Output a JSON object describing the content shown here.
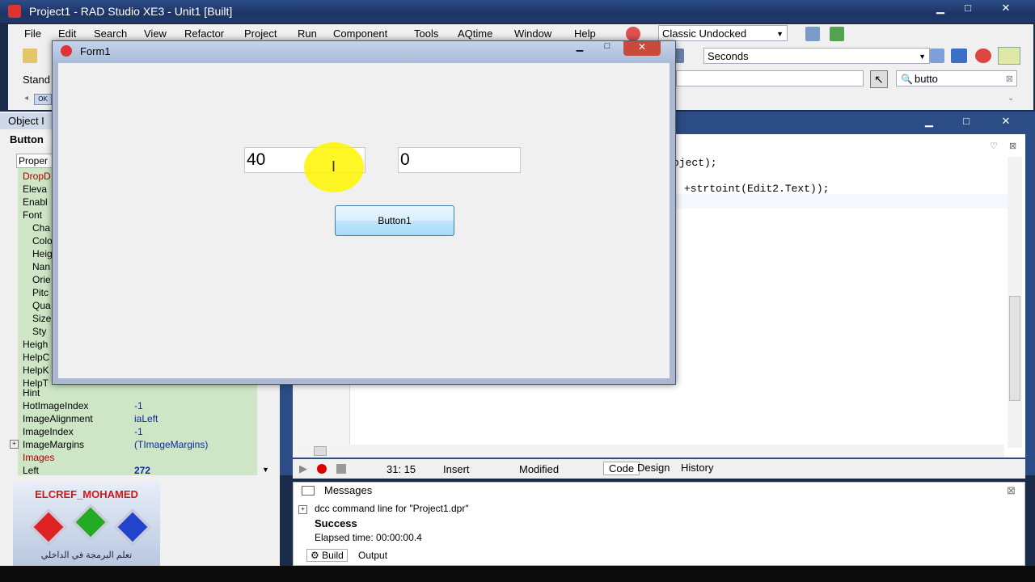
{
  "ide": {
    "title": "Project1 - RAD Studio XE3 - Unit1 [Built]",
    "menu": [
      "File",
      "Edit",
      "Search",
      "View",
      "Refactor",
      "Project",
      "Run",
      "Component",
      "Tools",
      "AQtime",
      "Window",
      "Help"
    ],
    "layout_combo": "Classic Undocked",
    "timer_combo": "Seconds",
    "search_value": "butto",
    "toolbar_left_label": "Stand"
  },
  "object_inspector": {
    "title": "Object I",
    "selected": "Button",
    "tab_label": "Proper",
    "rows_short": [
      "DropD",
      "Eleva",
      "Enabl",
      "Font",
      "Cha",
      "Colo",
      "Heig",
      "Nan",
      "Orie",
      "Pitc",
      "Qua",
      "Size",
      "Sty",
      "Heigh",
      "HelpC",
      "HelpK",
      "HelpT"
    ],
    "rows": [
      {
        "name": "Hint",
        "value": ""
      },
      {
        "name": "HotImageIndex",
        "value": "-1"
      },
      {
        "name": "ImageAlignment",
        "value": "iaLeft"
      },
      {
        "name": "ImageIndex",
        "value": "-1"
      },
      {
        "name": "ImageMargins",
        "value": "(TImageMargins)"
      },
      {
        "name": "Images",
        "value": ""
      },
      {
        "name": "Left",
        "value": "272"
      }
    ]
  },
  "form": {
    "title": "Form1",
    "edit1": "40",
    "edit2": "0",
    "button_label": "Button1"
  },
  "editor": {
    "line1": "bject);",
    "line2": "+strtoint(Edit2.Text));",
    "position": "31: 15",
    "mode": "Insert",
    "state": "Modified",
    "tabs": [
      "Code",
      "Design",
      "History"
    ]
  },
  "messages": {
    "title": "Messages",
    "line1": "dcc command line for \"Project1.dpr\"",
    "line2": "Success",
    "line3": "Elapsed time: 00:00:00.4",
    "tabs": [
      "Build",
      "Output"
    ]
  },
  "watermark": {
    "name": "ELCREF_MOHAMED",
    "tagline": "تعلم البرمجة في الداخلي"
  }
}
